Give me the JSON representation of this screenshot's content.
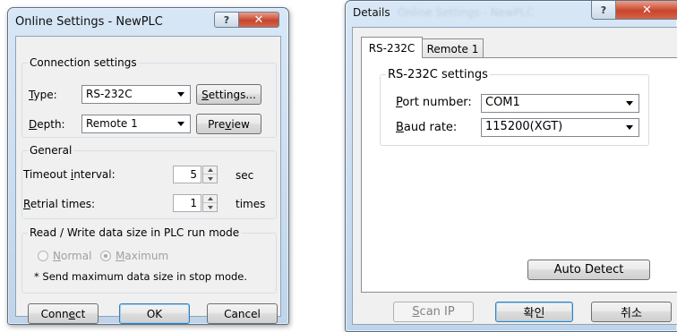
{
  "online_settings": {
    "title": "Online Settings - NewPLC",
    "connection": {
      "group_title": "Connection settings",
      "type_label": "Type:",
      "type_value": "RS-232C",
      "settings_button": "Settings...",
      "depth_label": "Depth:",
      "depth_value": "Remote 1",
      "preview_button": "Preview"
    },
    "general": {
      "group_title": "General",
      "timeout_label": "Timeout interval:",
      "timeout_value": "5",
      "timeout_unit": "sec",
      "retrial_label": "Retrial times:",
      "retrial_value": "1",
      "retrial_unit": "times"
    },
    "readwrite": {
      "group_title": "Read / Write data size in PLC run mode",
      "normal_label": "Normal",
      "maximum_label": "Maximum",
      "selected": "Maximum",
      "note": "* Send maximum data size in stop mode."
    },
    "buttons": {
      "connect": "Connect",
      "ok": "OK",
      "cancel": "Cancel"
    }
  },
  "details": {
    "title": "Details",
    "tabs": [
      {
        "label": "RS-232C",
        "active": true
      },
      {
        "label": "Remote 1",
        "active": false
      }
    ],
    "rs232c": {
      "group_title": "RS-232C settings",
      "port_label": "Port number:",
      "port_value": "COM1",
      "baud_label": "Baud rate:",
      "baud_value": "115200(XGT)"
    },
    "auto_detect_button": "Auto Detect",
    "buttons": {
      "scan_ip": "Scan IP",
      "ok": "확인",
      "cancel": "취소"
    }
  },
  "icons": {
    "help": "question-mark-icon",
    "close": "close-x-icon"
  },
  "colors": {
    "title_bar": "#c6d9ee",
    "dialog_body": "#f0f0f0",
    "close_red": "#c8452c",
    "default_button_border": "#3c7fb1"
  }
}
